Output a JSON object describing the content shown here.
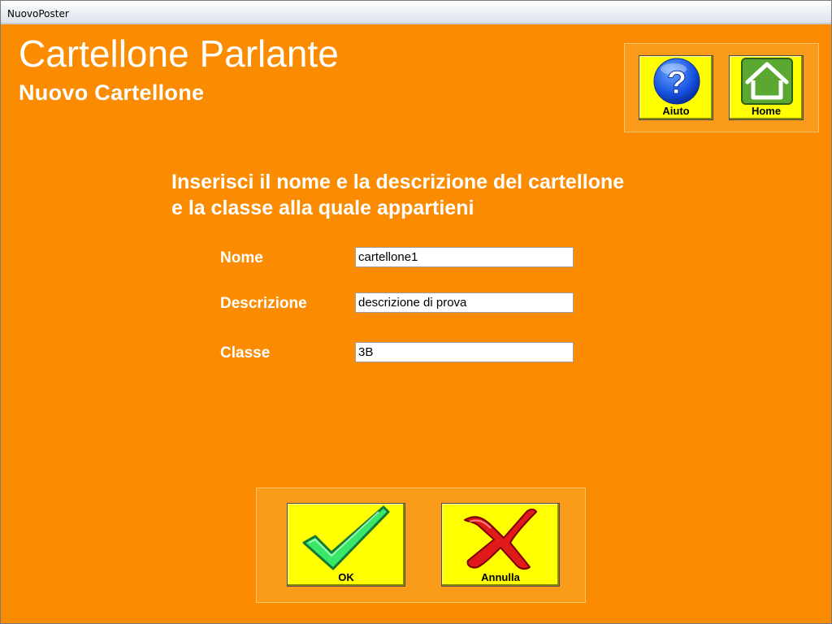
{
  "window": {
    "title": "NuovoPoster"
  },
  "header": {
    "title": "Cartellone Parlante",
    "subtitle": "Nuovo Cartellone"
  },
  "toolbar": {
    "help_label": "Aiuto",
    "home_label": "Home",
    "help_icon": "question-mark-icon",
    "home_icon": "home-icon"
  },
  "instructions": {
    "line1": "Inserisci il nome e la descrizione del cartellone",
    "line2": "e la classe alla quale appartieni"
  },
  "form": {
    "nome": {
      "label": "Nome",
      "value": "cartellone1"
    },
    "descrizione": {
      "label": "Descrizione",
      "value": "descrizione di prova"
    },
    "classe": {
      "label": "Classe",
      "value": "3B"
    }
  },
  "actions": {
    "ok_label": "OK",
    "cancel_label": "Annulla",
    "ok_icon": "checkmark-icon",
    "cancel_icon": "x-cross-icon"
  },
  "colors": {
    "background": "#fb8b00",
    "button_fill": "#ffff00",
    "panel": "#f99a18"
  }
}
